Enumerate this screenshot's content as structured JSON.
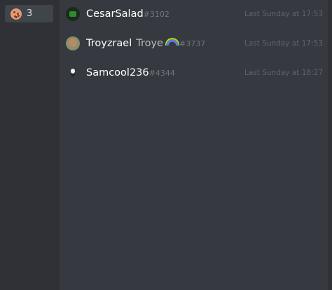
{
  "reaction": {
    "emoji": "cookie-emoji",
    "count": "3"
  },
  "users": [
    {
      "name": "CesarSalad",
      "nickname": "",
      "discriminator": "#3102",
      "time": "Last Sunday at 17:53",
      "avatar": "dark-avatar"
    },
    {
      "name": "Troyzrael",
      "nickname": "Troye",
      "emoji": "rainbow-emoji",
      "discriminator": "#3737",
      "time": "Last Sunday at 17:53",
      "avatar": "photo-avatar"
    },
    {
      "name": "Samcool236",
      "nickname": "",
      "discriminator": "#4344",
      "time": "Last Sunday at 18:27",
      "avatar": "penguin-avatar"
    }
  ]
}
